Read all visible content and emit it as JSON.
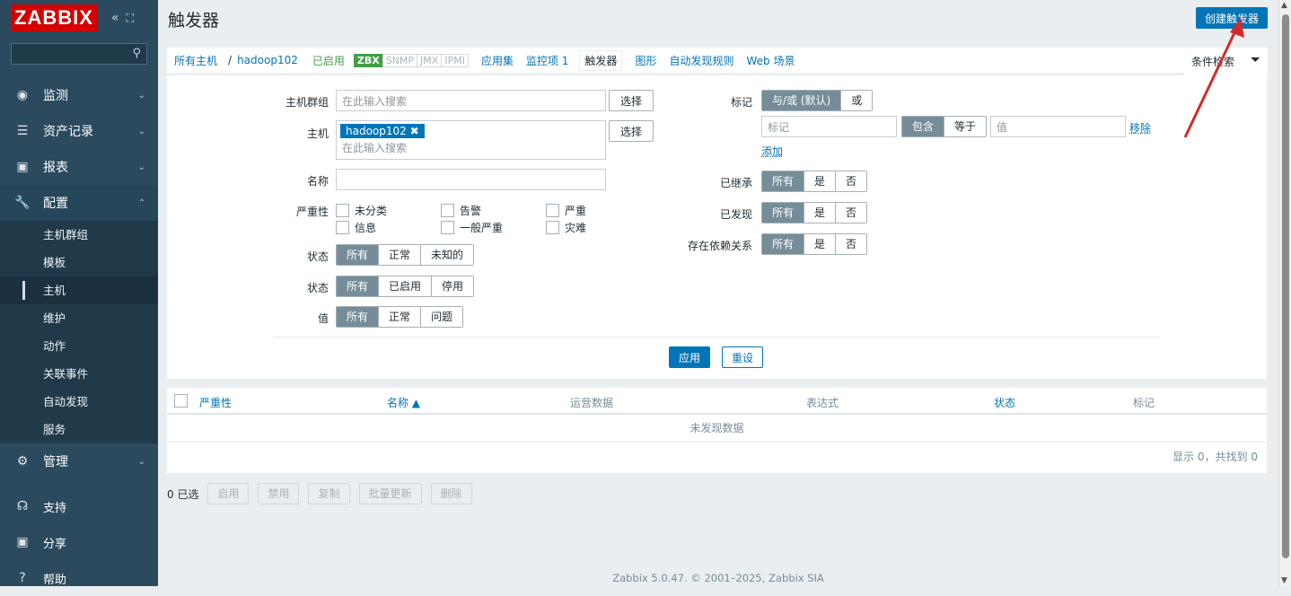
{
  "sidebar": {
    "logo": "ZABBIX",
    "collapse_icon": "«",
    "expand_icon": "⛶",
    "search_placeholder": "",
    "menu": [
      {
        "label": "监测",
        "icon": "eye-icon"
      },
      {
        "label": "资产记录",
        "icon": "list-icon"
      },
      {
        "label": "报表",
        "icon": "chart-icon"
      },
      {
        "label": "配置",
        "icon": "wrench-icon"
      },
      {
        "label": "管理",
        "icon": "gear-icon"
      }
    ],
    "sub": [
      "主机群组",
      "模板",
      "主机",
      "维护",
      "动作",
      "关联事件",
      "自动发现",
      "服务"
    ],
    "bottom": [
      {
        "label": "支持",
        "icon": "headset-icon"
      },
      {
        "label": "分享",
        "icon": "share-icon"
      },
      {
        "label": "帮助",
        "icon": "help-icon"
      }
    ]
  },
  "header": {
    "title": "触发器",
    "create_button": "创建触发器"
  },
  "nav": {
    "all_hosts": "所有主机",
    "separator": "/",
    "host": "hadoop102",
    "enabled": "已启用",
    "zbx": "ZBX",
    "snmp": "SNMP",
    "jmx": "JMX",
    "ipmi": "IPMI",
    "tabs": [
      "应用集",
      "监控项 1",
      "触发器",
      "图形",
      "自动发现规则",
      "Web 场景"
    ],
    "filter_tab": "条件检索"
  },
  "filter": {
    "host_group_label": "主机群组",
    "host_group_placeholder": "在此输入搜索",
    "select": "选择",
    "host_label": "主机",
    "host_chip": "hadoop102",
    "host_placeholder": "在此输入搜索",
    "name_label": "名称",
    "name_value": "",
    "severity_label": "严重性",
    "severities": [
      "未分类",
      "告警",
      "严重",
      "信息",
      "一般严重",
      "灾难"
    ],
    "state_label": "状态",
    "state_opts": [
      "所有",
      "正常",
      "未知的"
    ],
    "status_label": "状态",
    "status_opts": [
      "所有",
      "已启用",
      "停用"
    ],
    "value_label": "值",
    "value_opts": [
      "所有",
      "正常",
      "问题"
    ],
    "tags_label": "标记",
    "tag_op": [
      "与/或 (默认)",
      "或"
    ],
    "tag_placeholder": "标记",
    "tag_match": [
      "包含",
      "等于"
    ],
    "tag_value_placeholder": "值",
    "remove": "移除",
    "add": "添加",
    "inherited_label": "已继承",
    "discovered_label": "已发现",
    "depends_label": "存在依赖关系",
    "yesno": [
      "所有",
      "是",
      "否"
    ],
    "apply": "应用",
    "reset": "重设"
  },
  "table": {
    "columns": [
      "严重性",
      "名称 ▲",
      "运营数据",
      "表达式",
      "状态",
      "标记"
    ],
    "empty": "未发现数据",
    "footer": "显示 0，共找到 0"
  },
  "actions": {
    "selected": "0 已选",
    "buttons": [
      "启用",
      "禁用",
      "复制",
      "批量更新",
      "删除"
    ]
  },
  "footer": "Zabbix 5.0.47. © 2001–2025, Zabbix SIA",
  "colors": {
    "accent": "#0275b8",
    "sidebar": "#2b4a5e",
    "logo": "#d40000",
    "enabled": "#429e47",
    "annotation_arrow": "#d42a2a"
  }
}
